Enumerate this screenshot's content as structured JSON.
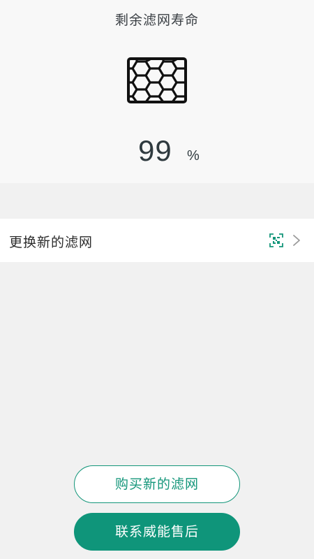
{
  "filter_status": {
    "title": "剩余滤网寿命",
    "remaining_life_value": "99",
    "remaining_life_unit": "%",
    "icon": "honeycomb-filter-icon"
  },
  "replace_filter": {
    "label": "更换新的滤网",
    "scan_icon": "qr-scan-icon",
    "arrow_icon": "chevron-right-icon"
  },
  "actions": {
    "buy_label": "购买新的滤网",
    "contact_label": "联系威能售后"
  },
  "colors": {
    "accent": "#0f957a",
    "background": "#f1f1f1",
    "panel": "#f8f8f8"
  }
}
